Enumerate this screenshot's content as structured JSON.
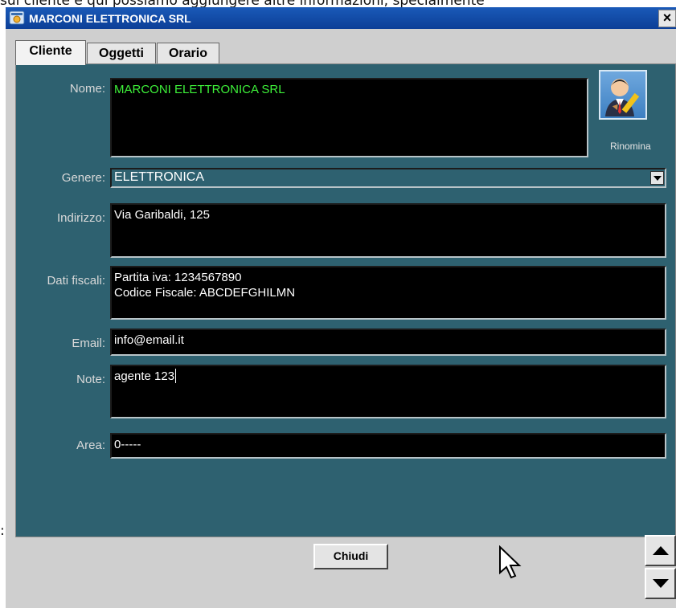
{
  "background": {
    "caption_text": "sul cliente e qui possiamo aggiungere altre informazioni, specialmente",
    "colon_text": ":"
  },
  "window": {
    "title": "MARCONI ELETTRONICA SRL",
    "close_label": "×"
  },
  "tabs": [
    {
      "label": "Cliente",
      "active": true
    },
    {
      "label": "Oggetti",
      "active": false
    },
    {
      "label": "Orario",
      "active": false
    }
  ],
  "form": {
    "nome": {
      "label": "Nome:",
      "value": "MARCONI ELETTRONICA SRL"
    },
    "genere": {
      "label": "Genere:",
      "value": "ELETTRONICA"
    },
    "indirizzo": {
      "label": "Indirizzo:",
      "value": "Via Garibaldi, 125"
    },
    "dati_fiscali": {
      "label": "Dati fiscali:",
      "value": "Partita iva: 1234567890\nCodice Fiscale: ABCDEFGHILMN"
    },
    "email": {
      "label": "Email:",
      "value": "info@email.it"
    },
    "note": {
      "label": "Note:",
      "value": "agente 123"
    },
    "area": {
      "label": "Area:",
      "value": "0-----"
    }
  },
  "rename": {
    "label": "Rinomina",
    "icon": "user-edit-icon"
  },
  "footer": {
    "close_button": "Chiudi"
  },
  "colors": {
    "title_bar": "#1a5ab8",
    "panel_bg": "#2e6170",
    "field_bg": "#000000",
    "name_text": "#3ef23a"
  }
}
